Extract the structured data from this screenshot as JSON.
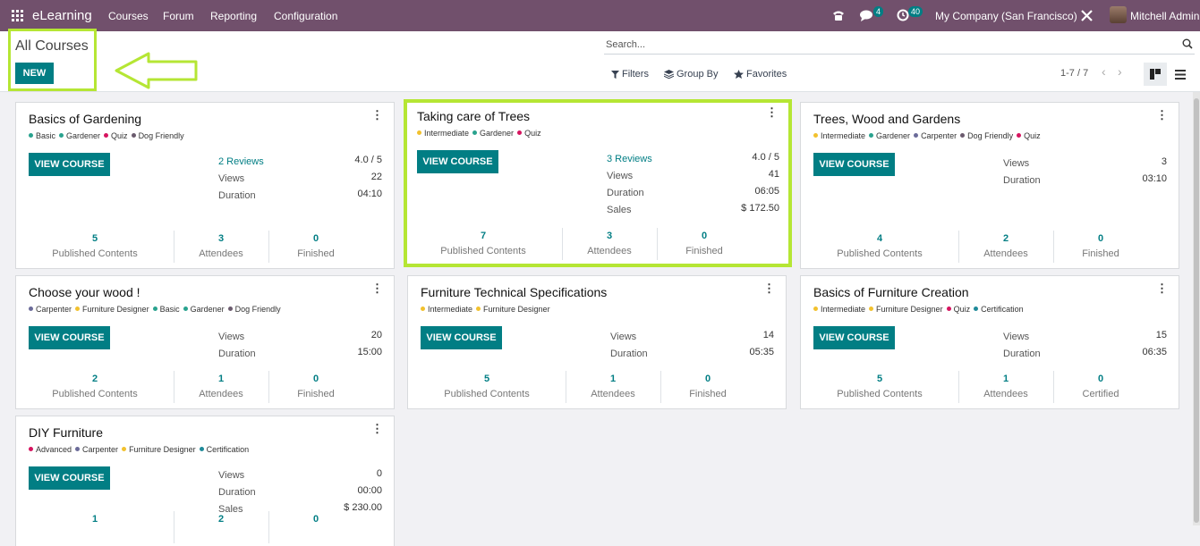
{
  "navbar": {
    "brand": "eLearning",
    "menu": [
      "Courses",
      "Forum",
      "Reporting",
      "Configuration"
    ],
    "chat_badge": "4",
    "activity_badge": "40",
    "company": "My Company (San Francisco)",
    "user": "Mitchell Admin"
  },
  "control": {
    "title": "All Courses",
    "new_label": "NEW",
    "search_placeholder": "Search...",
    "filters_label": "Filters",
    "groupby_label": "Group By",
    "favorites_label": "Favorites",
    "pager": "1-7 / 7"
  },
  "colors": {
    "navbar": "#71506c",
    "primary": "#017e84",
    "highlight": "#b5e634"
  },
  "courses": [
    {
      "title": "Basics of Gardening",
      "tags": [
        {
          "label": "Basic",
          "color": "#29a28e"
        },
        {
          "label": "Gardener",
          "color": "#29a28e"
        },
        {
          "label": "Quiz",
          "color": "#d6145f"
        },
        {
          "label": "Dog Friendly",
          "color": "#6b5b6e"
        }
      ],
      "button": "VIEW COURSE",
      "stats": [
        {
          "label": "2 Reviews",
          "value": "4.0 / 5",
          "link": true
        },
        {
          "label": "Views",
          "value": "22"
        },
        {
          "label": "Duration",
          "value": "04:10"
        }
      ],
      "footer": [
        {
          "num": "5",
          "label": "Published Contents"
        },
        {
          "num": "3",
          "label": "Attendees"
        },
        {
          "num": "0",
          "label": "Finished"
        }
      ]
    },
    {
      "title": "Taking care of Trees",
      "tags": [
        {
          "label": "Intermediate",
          "color": "#f2c12e"
        },
        {
          "label": "Gardener",
          "color": "#29a28e"
        },
        {
          "label": "Quiz",
          "color": "#d6145f"
        }
      ],
      "button": "VIEW COURSE",
      "stats": [
        {
          "label": "3 Reviews",
          "value": "4.0 / 5",
          "link": true
        },
        {
          "label": "Views",
          "value": "41"
        },
        {
          "label": "Duration",
          "value": "06:05"
        },
        {
          "label": "Sales",
          "value": "$ 172.50"
        }
      ],
      "footer": [
        {
          "num": "7",
          "label": "Published Contents"
        },
        {
          "num": "3",
          "label": "Attendees"
        },
        {
          "num": "0",
          "label": "Finished"
        }
      ]
    },
    {
      "title": "Trees, Wood and Gardens",
      "tags": [
        {
          "label": "Intermediate",
          "color": "#f2c12e"
        },
        {
          "label": "Gardener",
          "color": "#29a28e"
        },
        {
          "label": "Carpenter",
          "color": "#6b6b99"
        },
        {
          "label": "Dog Friendly",
          "color": "#6b5b6e"
        },
        {
          "label": "Quiz",
          "color": "#d6145f"
        }
      ],
      "button": "VIEW COURSE",
      "stats": [
        {
          "label": "Views",
          "value": "3"
        },
        {
          "label": "Duration",
          "value": "03:10"
        }
      ],
      "footer": [
        {
          "num": "4",
          "label": "Published Contents"
        },
        {
          "num": "2",
          "label": "Attendees"
        },
        {
          "num": "0",
          "label": "Finished"
        }
      ]
    },
    {
      "title": "Choose your wood !",
      "tags": [
        {
          "label": "Carpenter",
          "color": "#6b6b99"
        },
        {
          "label": "Furniture Designer",
          "color": "#f2c12e"
        },
        {
          "label": "Basic",
          "color": "#29a28e"
        },
        {
          "label": "Gardener",
          "color": "#29a28e"
        },
        {
          "label": "Dog Friendly",
          "color": "#6b5b6e"
        }
      ],
      "button": "VIEW COURSE",
      "stats": [
        {
          "label": "Views",
          "value": "20"
        },
        {
          "label": "Duration",
          "value": "15:00"
        }
      ],
      "footer": [
        {
          "num": "2",
          "label": "Published Contents"
        },
        {
          "num": "1",
          "label": "Attendees"
        },
        {
          "num": "0",
          "label": "Finished"
        }
      ]
    },
    {
      "title": "Furniture Technical Specifications",
      "tags": [
        {
          "label": "Intermediate",
          "color": "#f2c12e"
        },
        {
          "label": "Furniture Designer",
          "color": "#f2c12e"
        }
      ],
      "button": "VIEW COURSE",
      "stats": [
        {
          "label": "Views",
          "value": "14"
        },
        {
          "label": "Duration",
          "value": "05:35"
        }
      ],
      "footer": [
        {
          "num": "5",
          "label": "Published Contents"
        },
        {
          "num": "1",
          "label": "Attendees"
        },
        {
          "num": "0",
          "label": "Finished"
        }
      ]
    },
    {
      "title": "Basics of Furniture Creation",
      "tags": [
        {
          "label": "Intermediate",
          "color": "#f2c12e"
        },
        {
          "label": "Furniture Designer",
          "color": "#f2c12e"
        },
        {
          "label": "Quiz",
          "color": "#d6145f"
        },
        {
          "label": "Certification",
          "color": "#1f8a99"
        }
      ],
      "button": "VIEW COURSE",
      "stats": [
        {
          "label": "Views",
          "value": "15"
        },
        {
          "label": "Duration",
          "value": "06:35"
        }
      ],
      "footer": [
        {
          "num": "5",
          "label": "Published Contents"
        },
        {
          "num": "1",
          "label": "Attendees"
        },
        {
          "num": "0",
          "label": "Certified"
        }
      ]
    },
    {
      "title": "DIY Furniture",
      "tags": [
        {
          "label": "Advanced",
          "color": "#d6145f"
        },
        {
          "label": "Carpenter",
          "color": "#6b6b99"
        },
        {
          "label": "Furniture Designer",
          "color": "#f2c12e"
        },
        {
          "label": "Certification",
          "color": "#1f8a99"
        }
      ],
      "button": "VIEW COURSE",
      "stats": [
        {
          "label": "Views",
          "value": "0"
        },
        {
          "label": "Duration",
          "value": "00:00"
        },
        {
          "label": "Sales",
          "value": "$ 230.00"
        }
      ],
      "footer": [
        {
          "num": "1",
          "label": ""
        },
        {
          "num": "2",
          "label": ""
        },
        {
          "num": "0",
          "label": ""
        }
      ]
    }
  ]
}
